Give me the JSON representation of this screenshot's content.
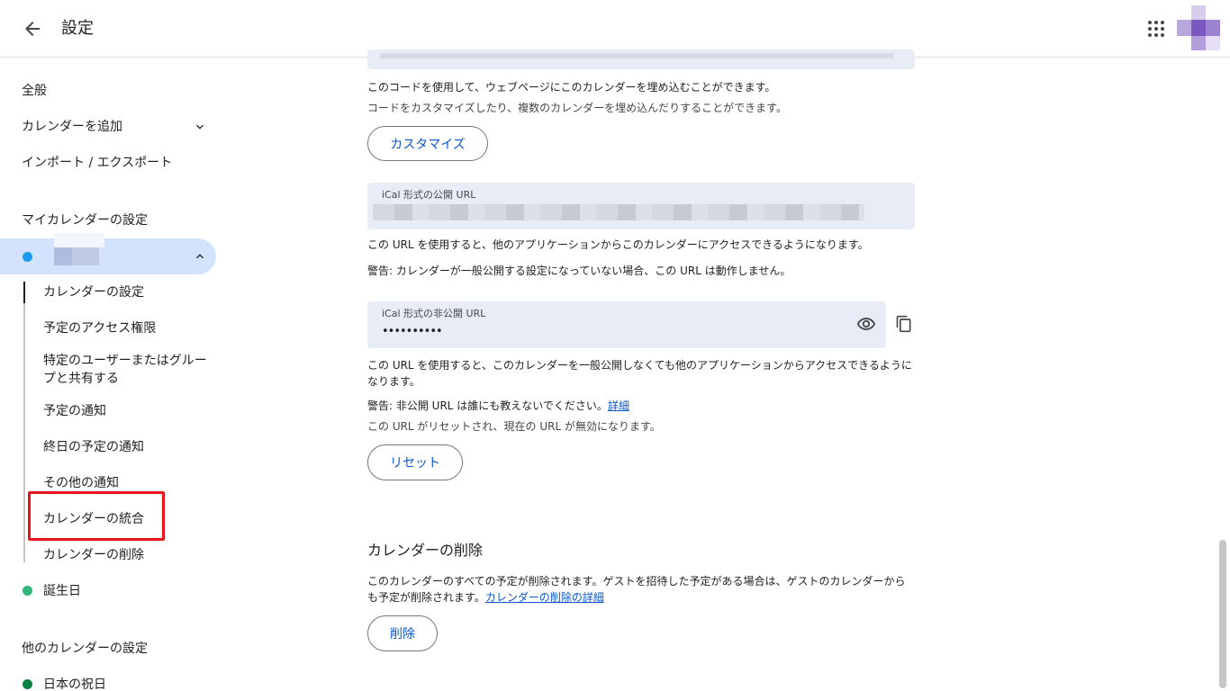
{
  "header": {
    "title": "設定"
  },
  "sidebar": {
    "general": "全般",
    "add_calendar": "カレンダーを追加",
    "import_export": "インポート / エクスポート",
    "my_calendars_label": "マイカレンダーの設定",
    "selected_calendar_color": "#1a9af0",
    "sub_items": [
      "カレンダーの設定",
      "予定のアクセス権限",
      "特定のユーザーまたはグループと共有する",
      "予定の通知",
      "終日の予定の通知",
      "その他の通知",
      "カレンダーの統合",
      "カレンダーの削除"
    ],
    "birthday": "誕生日",
    "birthday_color": "#33b679",
    "other_calendars_label": "他のカレンダーの設定",
    "holidays": "日本の祝日",
    "holidays_color": "#0b8043"
  },
  "main": {
    "embed_desc_1": "このコードを使用して、ウェブページにこのカレンダーを埋め込むことができます。",
    "embed_desc_2": "コードをカスタマイズしたり、複数のカレンダーを埋め込んだりすることができます。",
    "customize_button": "カスタマイズ",
    "public_ical_label": "iCal 形式の公開 URL",
    "public_desc": "この URL を使用すると、他のアプリケーションからこのカレンダーにアクセスできるようになります。",
    "public_warning": "警告: カレンダーが一般公開する設定になっていない場合、この URL は動作しません。",
    "private_ical_label": "iCal 形式の非公開 URL",
    "private_ical_value": "••••••••••",
    "private_desc": "この URL を使用すると、このカレンダーを一般公開しなくても他のアプリケーションからアクセスできるようになります。",
    "private_warning_prefix": "警告: 非公開 URL は誰にも教えないでください。",
    "private_warning_link": "詳細",
    "reset_desc": "この URL がリセットされ、現在の URL が無効になります。",
    "reset_button": "リセット",
    "delete_title": "カレンダーの削除",
    "delete_desc": "このカレンダーのすべての予定が削除されます。ゲストを招待した予定がある場合は、ゲストのカレンダーからも予定が削除されます。",
    "delete_link": "カレンダーの削除の詳細",
    "delete_button": "削除"
  },
  "colors": {
    "accent": "#0b57d0",
    "selected_bg": "#d3e3fd",
    "field_bg": "#e8ecf6",
    "highlight": "#e8141c"
  }
}
